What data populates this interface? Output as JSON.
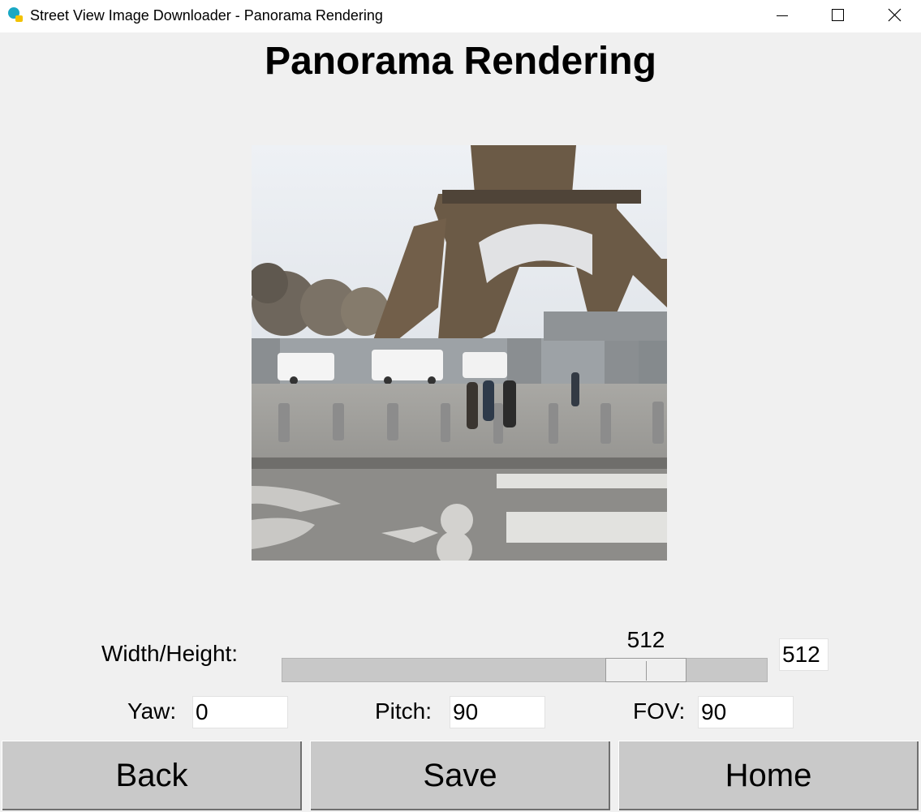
{
  "window": {
    "title": "Street View Image Downloader - Panorama Rendering",
    "icon": "app-logo-icon",
    "controls": [
      "minimize-icon",
      "maximize-icon",
      "close-icon"
    ]
  },
  "page": {
    "heading": "Panorama Rendering"
  },
  "preview": {
    "description": "panorama-render-image"
  },
  "size_control": {
    "label": "Width/Height:",
    "slider_value": "512",
    "entry_value": "512"
  },
  "angles": {
    "yaw_label": "Yaw:",
    "yaw_value": "0",
    "pitch_label": "Pitch:",
    "pitch_value": "90",
    "fov_label": "FOV:",
    "fov_value": "90"
  },
  "buttons": {
    "back": "Back",
    "save": "Save",
    "home": "Home"
  },
  "colors": {
    "background": "#f0f0f0",
    "button": "#c9c9c9",
    "trough": "#c8c8c8"
  }
}
